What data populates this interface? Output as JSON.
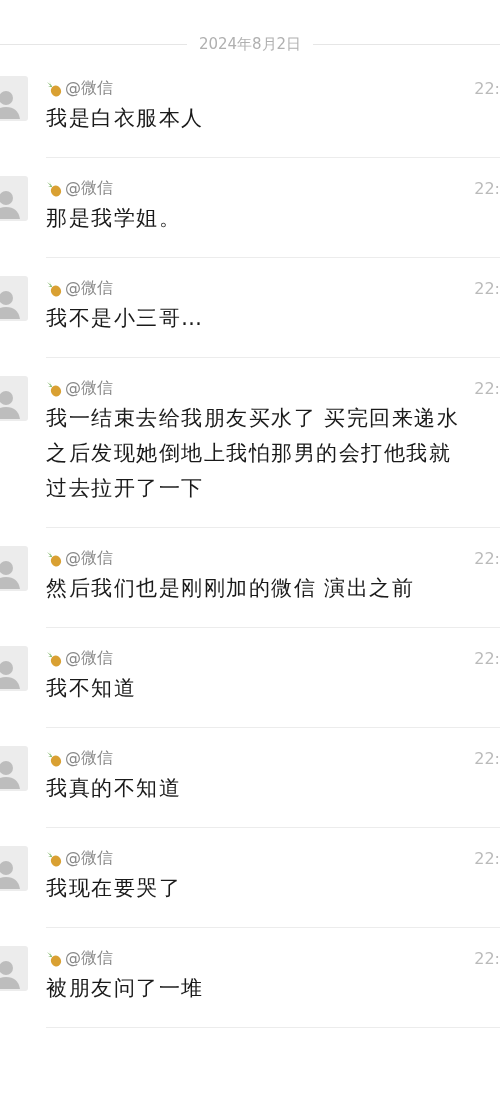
{
  "date_divider": "2024年8月2日",
  "messages": [
    {
      "sender": "@微信",
      "time": "22:",
      "lines": [
        "我是白衣服本人"
      ]
    },
    {
      "sender": "@微信",
      "time": "22:",
      "lines": [
        "那是我学姐。"
      ]
    },
    {
      "sender": "@微信",
      "time": "22:",
      "lines": [
        "我不是小三哥…"
      ]
    },
    {
      "sender": "@微信",
      "time": "22:",
      "lines": [
        "我一结束去给我朋友买水了 买完回来递水",
        "之后发现她倒地上我怕那男的会打他我就",
        "过去拉开了一下"
      ]
    },
    {
      "sender": "@微信",
      "time": "22:",
      "lines": [
        "然后我们也是刚刚加的微信 演出之前"
      ]
    },
    {
      "sender": "@微信",
      "time": "22:",
      "lines": [
        "我不知道"
      ]
    },
    {
      "sender": "@微信",
      "time": "22:",
      "lines": [
        "我真的不知道"
      ]
    },
    {
      "sender": "@微信",
      "time": "22:",
      "lines": [
        "我现在要哭了"
      ]
    },
    {
      "sender": "@微信",
      "time": "22:",
      "lines": [
        "被朋友问了一堆"
      ]
    }
  ]
}
